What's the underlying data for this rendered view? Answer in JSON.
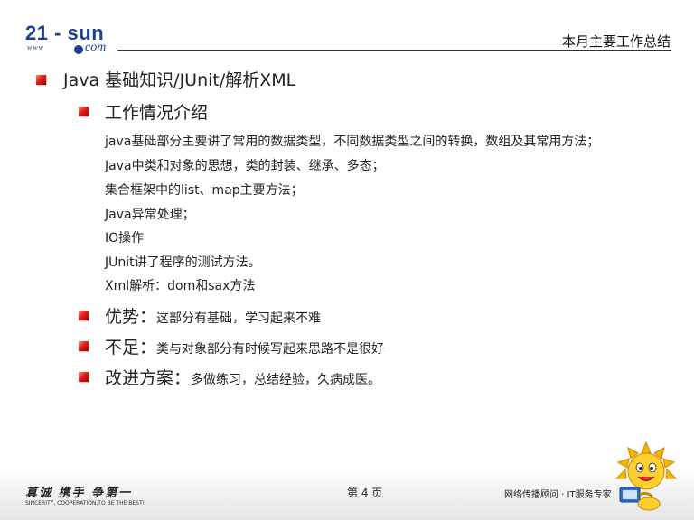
{
  "header": {
    "logo_main": "21 - sun",
    "logo_www": "www",
    "logo_com": "com",
    "title": "本月主要工作总结"
  },
  "content": {
    "heading": "Java 基础知识/JUnit/解析XML",
    "work_title": "工作情况介绍",
    "details": [
      "java基础部分主要讲了常用的数据类型，不同数据类型之间的转换，数组及其常用方法；",
      "Java中类和对象的思想，类的封装、继承、多态；",
      "集合框架中的list、map主要方法；",
      "Java异常处理；",
      "IO操作",
      "JUnit讲了程序的测试方法。",
      "Xml解析：dom和sax方法"
    ],
    "advantage_label": "优势：",
    "advantage_text": "这部分有基础，学习起来不难",
    "shortcoming_label": "不足：",
    "shortcoming_text": "类与对象部分有时候写起来思路不是很好",
    "improve_label": "改进方案：",
    "improve_text": "多做练习，总结经验，久病成医。"
  },
  "footer": {
    "slogan": "真诚 携手 争第一",
    "slogan_en": "SINCERITY, COOPERATION,TO BE THE BEST!",
    "page": "第 4 页",
    "tagline": "网络传播顾问 · IT服务专家"
  },
  "colors": {
    "brand_blue": "#1d3f8f",
    "bullet_red": "#e0201a"
  }
}
